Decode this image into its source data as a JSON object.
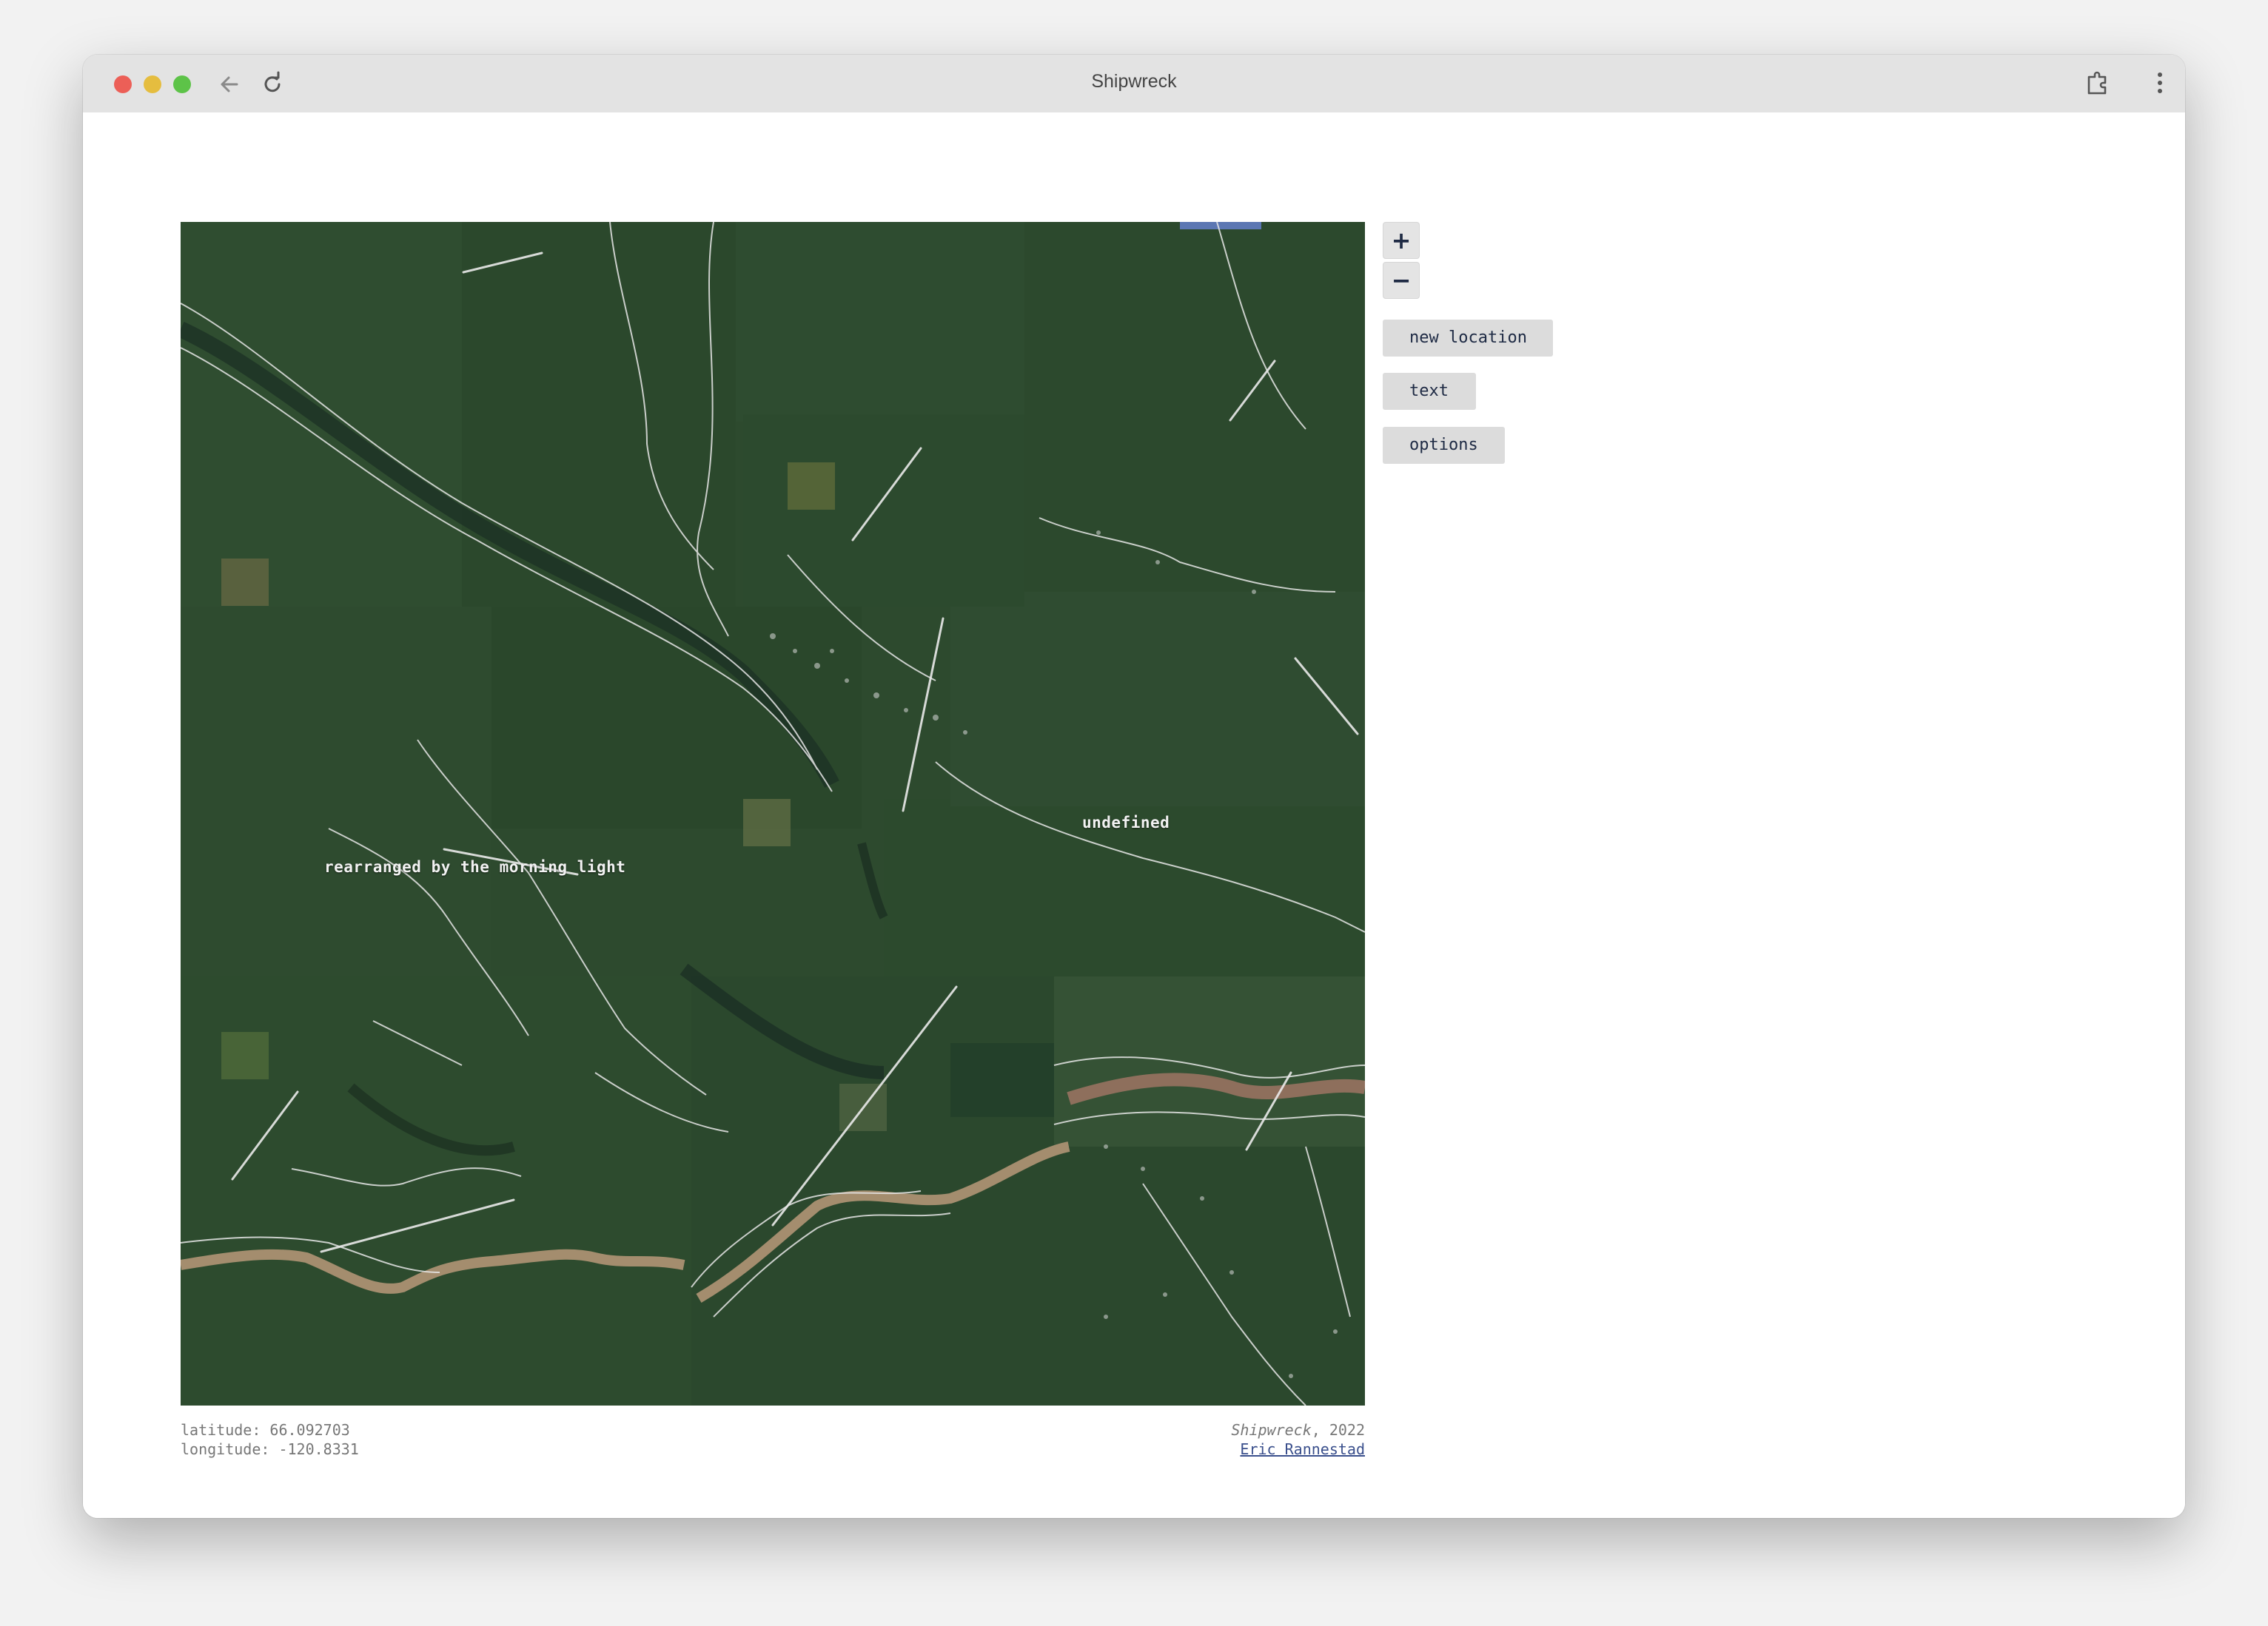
{
  "window": {
    "title": "Shipwreck"
  },
  "icons": {
    "back": "arrow-left-icon",
    "reload": "reload-icon",
    "extension": "puzzle-extension-icon",
    "menu": "kebab-menu-icon"
  },
  "map": {
    "labels": [
      "rearranged by the morning light",
      "undefined"
    ],
    "colors": {
      "forest": "#2c4a2d",
      "river_line": "#e8e8e8",
      "muddy_river": "#a48d6e"
    }
  },
  "controls": {
    "zoom_in": "+",
    "zoom_out": "−",
    "new_location": "new location",
    "text": "text",
    "options": "options"
  },
  "footer": {
    "latitude": "latitude: 66.092703",
    "longitude": "longitude: -120.8331",
    "work_title": "Shipwreck",
    "year": ", 2022",
    "author": "Eric Rannestad"
  }
}
